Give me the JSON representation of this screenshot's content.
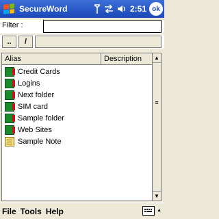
{
  "titlebar": {
    "title": "SecureWord",
    "time": "2:51",
    "ok_label": "ok",
    "icons": [
      "windows-start-icon",
      "antenna-icon",
      "sync-arrows-icon",
      "volume-icon"
    ]
  },
  "filter": {
    "label": "Filter :",
    "value": ""
  },
  "nav": {
    "up_label": "..",
    "root_label": "/",
    "path": ""
  },
  "list": {
    "columns": [
      "Alias",
      "Description"
    ],
    "items": [
      {
        "alias": "Credit Cards",
        "description": "",
        "icon": "folder-icon"
      },
      {
        "alias": "Logins",
        "description": "",
        "icon": "folder-icon"
      },
      {
        "alias": "Next folder",
        "description": "",
        "icon": "folder-icon"
      },
      {
        "alias": "SIM card",
        "description": "",
        "icon": "folder-icon"
      },
      {
        "alias": "Sample folder",
        "description": "",
        "icon": "folder-icon"
      },
      {
        "alias": "Web Sites",
        "description": "",
        "icon": "folder-icon"
      },
      {
        "alias": "Sample Note",
        "description": "",
        "icon": "note-icon"
      }
    ]
  },
  "menu": {
    "file": "File",
    "tools": "Tools",
    "help": "Help"
  },
  "colors": {
    "titlebar": "#1b48b8",
    "background": "#ece9d8",
    "folder": "#1a8a2e",
    "folder_tab": "#c9141a",
    "note": "#f5e27a"
  }
}
